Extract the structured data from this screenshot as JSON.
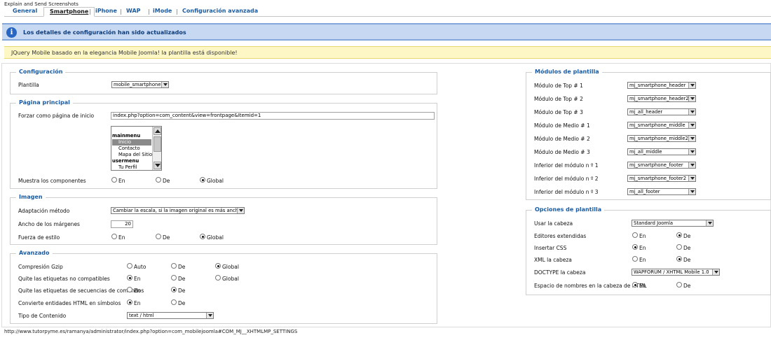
{
  "window": {
    "title": "Explain and Send Screenshots"
  },
  "tabs": [
    {
      "label": "General",
      "active": false
    },
    {
      "label": "Smartphone",
      "active": true
    },
    {
      "label": "iPhone",
      "active": false
    },
    {
      "label": "WAP",
      "active": false
    },
    {
      "label": "iMode",
      "active": false
    },
    {
      "label": "Configuración avanzada",
      "active": false
    }
  ],
  "messages": {
    "info": "Los detalles de configuración han sido actualizados",
    "notice": "JQuery Mobile basado en la elegancia Mobile Joomla! la plantilla está disponible!"
  },
  "configuracion": {
    "legend": "Configuración",
    "plantilla_label": "Plantilla",
    "plantilla_value": "mobile_smartphone"
  },
  "pagina": {
    "legend": "Página principal",
    "forzar_label": "Forzar como página de inicio",
    "forzar_value": "index.php?option=com_content&view=frontpage&Itemid=1",
    "menu_items": [
      {
        "text": "mainmenu",
        "type": "group"
      },
      {
        "text": "Inicio",
        "type": "item",
        "selected": true
      },
      {
        "text": "Contacto",
        "type": "item"
      },
      {
        "text": "Mapa del Sitio",
        "type": "item"
      },
      {
        "text": "usermenu",
        "type": "group"
      },
      {
        "text": "Tu Perfil",
        "type": "item"
      }
    ],
    "muestra_label": "Muestra los componentes",
    "options": [
      "En",
      "De",
      "Global"
    ],
    "muestra_selected": "Global"
  },
  "imagen": {
    "legend": "Imagen",
    "adapt_label": "Adaptación método",
    "adapt_value": "Cambiar la escala, si la imagen original es más ancha",
    "ancho_label": "Ancho de los márgenes",
    "ancho_value": "20",
    "fuerza_label": "Fuerza de estilo",
    "options": [
      "En",
      "De",
      "Global"
    ],
    "fuerza_selected": "Global"
  },
  "avanzado": {
    "legend": "Avanzado",
    "gzip_label": "Compresión Gzip",
    "gzip_options": [
      "Auto",
      "De",
      "Global"
    ],
    "gzip_selected": "Global",
    "quite_label": "Quite las etiquetas no compatibles",
    "quite_options": [
      "En",
      "De",
      "Global"
    ],
    "quite_selected": "En",
    "secuencias_label": "Quite las etiquetas de secuencias de comandos",
    "secuencias_options": [
      "En",
      "De"
    ],
    "secuencias_selected": "De",
    "entidades_label": "Convierte entidades HTML en símbolos",
    "entidades_options": [
      "En",
      "De"
    ],
    "entidades_selected": "En",
    "tipo_label": "Tipo de Contenido",
    "tipo_value": "text / html"
  },
  "modulos": {
    "legend": "Módulos de plantilla",
    "rows": [
      {
        "label": "Módulo de Top # 1",
        "value": "mj_smartphone_header"
      },
      {
        "label": "Módulo de Top # 2",
        "value": "mj_smartphone_header2"
      },
      {
        "label": "Módulo de Top # 3",
        "value": "mj_all_header"
      },
      {
        "label": "Módulo de Medio # 1",
        "value": "mj_smartphone_middle"
      },
      {
        "label": "Módulo de Medio # 2",
        "value": "mj_smartphone_middle2"
      },
      {
        "label": "Módulo de Medio # 3",
        "value": "mj_all_middle"
      },
      {
        "label": "Inferior del módulo n º 1",
        "value": "mj_smartphone_footer"
      },
      {
        "label": "Inferior del módulo n º 2",
        "value": "mj_smartphone_footer2"
      },
      {
        "label": "Inferior del módulo n º 3",
        "value": "mj_all_footer"
      }
    ]
  },
  "opciones": {
    "legend": "Opciones de plantilla",
    "cabeza_label": "Usar la cabeza",
    "cabeza_value": "Standard Joomla",
    "editores_label": "Editores extendidas",
    "editores_selected": "De",
    "css_label": "Insertar CSS",
    "css_selected": "En",
    "xml_label": "XML la cabeza",
    "xml_selected": "De",
    "doctype_label": "DOCTYPE la cabeza",
    "doctype_value": "WAPFORUM / XHTML Mobile 1.0",
    "espacio_label": "Espacio de nombres en la cabeza de HTML",
    "espacio_selected": "En",
    "options": [
      "En",
      "De"
    ]
  },
  "status": {
    "url": "http://www.tutorpyme.es/ramanya/administrator/index.php?option=com_mobilejoomla#COM_MJ__XHTMLMP_SETTINGS"
  }
}
